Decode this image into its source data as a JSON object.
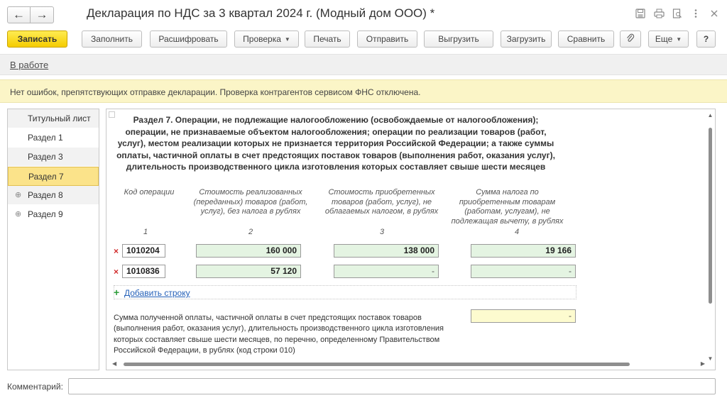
{
  "window": {
    "title": "Декларация по НДС за 3 квартал 2024 г. (Модный дом ООО) *",
    "back_glyph": "←",
    "forward_glyph": "→"
  },
  "icons": {
    "back": "arrow-left-icon",
    "forward": "arrow-right-icon",
    "save": "floppy-disk-icon",
    "print": "printer-icon",
    "preview": "print-preview-icon",
    "more": "more-vertical-icon",
    "close": "close-icon",
    "attach": "paperclip-icon",
    "delete": "delete-x-icon",
    "add": "plus-icon"
  },
  "toolbar": {
    "save_label": "Записать",
    "fill_label": "Заполнить",
    "decode_label": "Расшифровать",
    "check_label": "Проверка",
    "print_label": "Печать",
    "send_label": "Отправить",
    "export_label": "Выгрузить",
    "import_label": "Загрузить",
    "compare_label": "Сравнить",
    "more_label": "Еще",
    "help_label": "?"
  },
  "status": {
    "link": "В работе"
  },
  "info": {
    "message": "Нет ошибок, препятствующих отправке декларации. Проверка контрагентов сервисом ФНС отключена."
  },
  "sidebar": {
    "items": [
      {
        "label": "Титульный лист",
        "expandable": false
      },
      {
        "label": "Раздел 1",
        "expandable": false
      },
      {
        "label": "Раздел 3",
        "expandable": false
      },
      {
        "label": "Раздел 7",
        "expandable": false,
        "active": true
      },
      {
        "label": "Раздел 8",
        "expandable": true
      },
      {
        "label": "Раздел 9",
        "expandable": true
      }
    ],
    "expand_glyph": "⊕"
  },
  "section": {
    "title": "Раздел 7. Операции, не подлежащие налогообложению (освобождаемые от налогообложения); операции, не признаваемые объектом налогообложения; операции по реализации товаров (работ, услуг), местом реализации которых не признается территория Российской Федерации; а также суммы оплаты, частичной оплаты в счет предстоящих поставок товаров (выполнения работ, оказания услуг), длительность производственного цикла изготовления которых составляет свыше шести месяцев",
    "columns": [
      {
        "header": "Код операции",
        "num": "1"
      },
      {
        "header": "Стоимость реализованных (переданных) товаров (работ, услуг), без налога в рублях",
        "num": "2"
      },
      {
        "header": "Стоимость приобретенных товаров (работ, услуг), не облагаемых налогом, в рублях",
        "num": "3"
      },
      {
        "header": "Сумма налога по приобретенным товарам (работам, услугам), не подлежащая вычету, в рублях",
        "num": "4"
      }
    ],
    "rows": [
      {
        "code": "1010204",
        "sold": "160 000",
        "purchased": "138 000",
        "tax": "19 166",
        "delete_glyph": "×"
      },
      {
        "code": "1010836",
        "sold": "57 120",
        "purchased": "-",
        "tax": "-",
        "delete_glyph": "×"
      }
    ],
    "add_row_glyph": "+",
    "add_row_label": "Добавить строку",
    "summary_text": "Сумма полученной оплаты, частичной оплаты в счет предстоящих поставок товаров (выполнения работ, оказания услуг), длительность производственного цикла изготовления которых составляет свыше шести месяцев, по перечню, определенному Правительством Российской Федерации, в рублях (код строки 010)",
    "summary_value": "-"
  },
  "comment": {
    "label": "Комментарий:",
    "value": ""
  },
  "colors": {
    "primary_button": "#f5cc00",
    "active_nav": "#fbe38a",
    "info_bar": "#fbf5c7",
    "filled_field": "#e4f4e2",
    "summary_field": "#fdfbcf",
    "link": "#2460b8",
    "delete": "#d12b2b",
    "add": "#2d9e3a"
  }
}
